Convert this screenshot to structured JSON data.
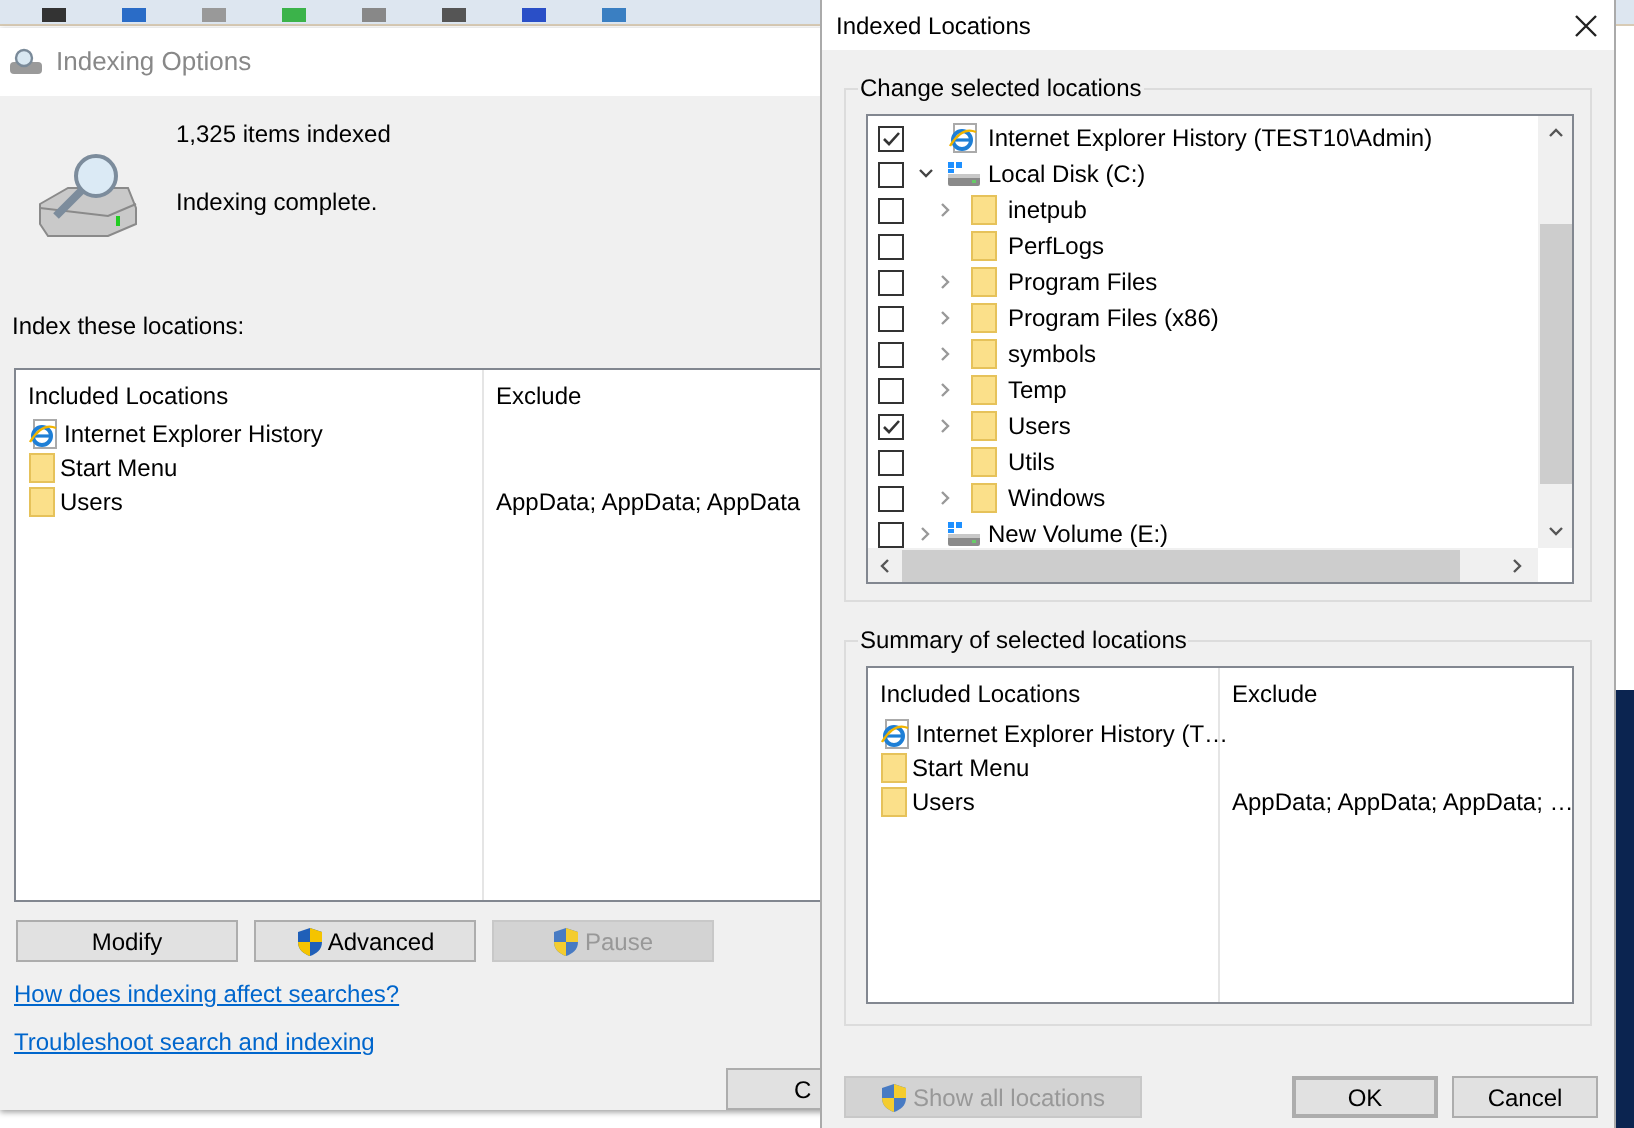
{
  "indexing_window": {
    "title": "Indexing Options",
    "items_indexed": "1,325 items indexed",
    "status": "Indexing complete.",
    "locations_label": "Index these locations:",
    "table": {
      "columns": [
        "Included Locations",
        "Exclude"
      ],
      "rows": [
        {
          "kind": "web",
          "location": "Internet Explorer History",
          "exclude": ""
        },
        {
          "kind": "folder",
          "location": "Start Menu",
          "exclude": ""
        },
        {
          "kind": "folder",
          "location": "Users",
          "exclude": "AppData; AppData; AppData"
        }
      ]
    },
    "buttons": [
      {
        "label": "Modify",
        "shield": false,
        "disabled": false
      },
      {
        "label": "Advanced",
        "shield": true,
        "disabled": false
      },
      {
        "label": "Pause",
        "shield": true,
        "disabled": true
      }
    ],
    "links": [
      "How does indexing affect searches?",
      "Troubleshoot search and indexing"
    ],
    "close_button": "C"
  },
  "dialog": {
    "title": "Indexed Locations",
    "change_group": "Change selected locations",
    "tree": [
      {
        "kind": "web",
        "label": "Internet Explorer History (TEST10\\Admin)",
        "checked": true,
        "expandable": false
      },
      {
        "kind": "drive",
        "label": "Local Disk (C:)",
        "checked": false,
        "expandable": true,
        "expanded": true,
        "children": [
          {
            "kind": "folder",
            "label": "inetpub",
            "checked": false,
            "expandable": true,
            "expanded": false
          },
          {
            "kind": "folder",
            "label": "PerfLogs",
            "checked": false,
            "expandable": false
          },
          {
            "kind": "folder",
            "label": "Program Files",
            "checked": false,
            "expandable": true,
            "expanded": false
          },
          {
            "kind": "folder",
            "label": "Program Files (x86)",
            "checked": false,
            "expandable": true,
            "expanded": false
          },
          {
            "kind": "folder",
            "label": "symbols",
            "checked": false,
            "expandable": true,
            "expanded": false
          },
          {
            "kind": "folder",
            "label": "Temp",
            "checked": false,
            "expandable": true,
            "expanded": false
          },
          {
            "kind": "folder",
            "label": "Users",
            "checked": true,
            "expandable": true,
            "expanded": false
          },
          {
            "kind": "folder",
            "label": "Utils",
            "checked": false,
            "expandable": false
          },
          {
            "kind": "folder",
            "label": "Windows",
            "checked": false,
            "expandable": true,
            "expanded": false
          }
        ]
      },
      {
        "kind": "drive",
        "label": "New Volume (E:)",
        "checked": false,
        "expandable": true,
        "expanded": false
      }
    ],
    "summary_group": "Summary of selected locations",
    "summary": {
      "columns": [
        "Included Locations",
        "Exclude"
      ],
      "rows": [
        {
          "kind": "web",
          "location": "Internet Explorer History (T…",
          "exclude": ""
        },
        {
          "kind": "folder",
          "location": "Start Menu",
          "exclude": ""
        },
        {
          "kind": "folder",
          "location": "Users",
          "exclude": "AppData; AppData; AppData; …"
        }
      ]
    },
    "buttons": [
      {
        "label": "Show all locations",
        "shield": true,
        "disabled": true,
        "default": false
      },
      {
        "label": "OK",
        "shield": false,
        "disabled": false,
        "default": true
      },
      {
        "label": "Cancel",
        "shield": false,
        "disabled": false,
        "default": false
      }
    ]
  }
}
